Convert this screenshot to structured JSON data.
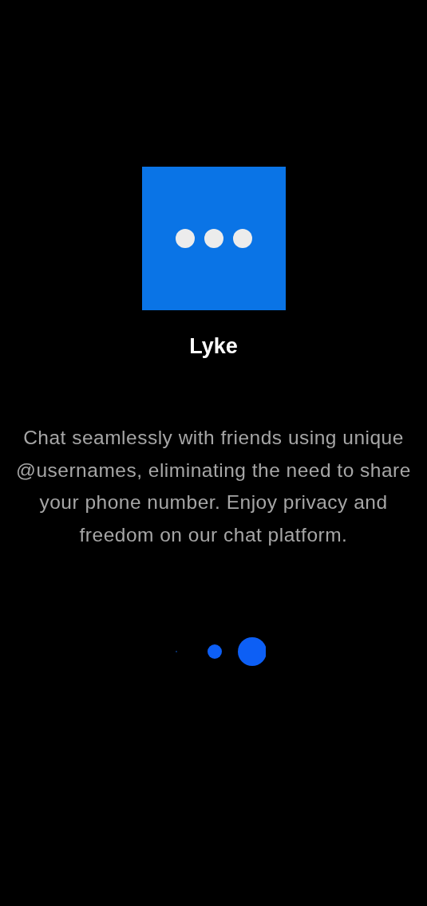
{
  "app": {
    "name": "Lyke"
  },
  "description": "Chat seamlessly with friends using unique @usernames, eliminating the need to share your phone number. Enjoy privacy and freedom on our chat platform."
}
